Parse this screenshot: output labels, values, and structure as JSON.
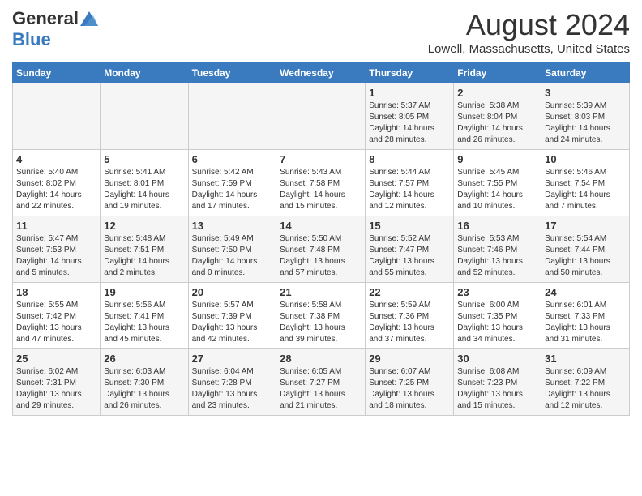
{
  "header": {
    "logo_general": "General",
    "logo_blue": "Blue",
    "month_year": "August 2024",
    "location": "Lowell, Massachusetts, United States"
  },
  "weekdays": [
    "Sunday",
    "Monday",
    "Tuesday",
    "Wednesday",
    "Thursday",
    "Friday",
    "Saturday"
  ],
  "weeks": [
    [
      {
        "day": "",
        "info": ""
      },
      {
        "day": "",
        "info": ""
      },
      {
        "day": "",
        "info": ""
      },
      {
        "day": "",
        "info": ""
      },
      {
        "day": "1",
        "info": "Sunrise: 5:37 AM\nSunset: 8:05 PM\nDaylight: 14 hours\nand 28 minutes."
      },
      {
        "day": "2",
        "info": "Sunrise: 5:38 AM\nSunset: 8:04 PM\nDaylight: 14 hours\nand 26 minutes."
      },
      {
        "day": "3",
        "info": "Sunrise: 5:39 AM\nSunset: 8:03 PM\nDaylight: 14 hours\nand 24 minutes."
      }
    ],
    [
      {
        "day": "4",
        "info": "Sunrise: 5:40 AM\nSunset: 8:02 PM\nDaylight: 14 hours\nand 22 minutes."
      },
      {
        "day": "5",
        "info": "Sunrise: 5:41 AM\nSunset: 8:01 PM\nDaylight: 14 hours\nand 19 minutes."
      },
      {
        "day": "6",
        "info": "Sunrise: 5:42 AM\nSunset: 7:59 PM\nDaylight: 14 hours\nand 17 minutes."
      },
      {
        "day": "7",
        "info": "Sunrise: 5:43 AM\nSunset: 7:58 PM\nDaylight: 14 hours\nand 15 minutes."
      },
      {
        "day": "8",
        "info": "Sunrise: 5:44 AM\nSunset: 7:57 PM\nDaylight: 14 hours\nand 12 minutes."
      },
      {
        "day": "9",
        "info": "Sunrise: 5:45 AM\nSunset: 7:55 PM\nDaylight: 14 hours\nand 10 minutes."
      },
      {
        "day": "10",
        "info": "Sunrise: 5:46 AM\nSunset: 7:54 PM\nDaylight: 14 hours\nand 7 minutes."
      }
    ],
    [
      {
        "day": "11",
        "info": "Sunrise: 5:47 AM\nSunset: 7:53 PM\nDaylight: 14 hours\nand 5 minutes."
      },
      {
        "day": "12",
        "info": "Sunrise: 5:48 AM\nSunset: 7:51 PM\nDaylight: 14 hours\nand 2 minutes."
      },
      {
        "day": "13",
        "info": "Sunrise: 5:49 AM\nSunset: 7:50 PM\nDaylight: 14 hours\nand 0 minutes."
      },
      {
        "day": "14",
        "info": "Sunrise: 5:50 AM\nSunset: 7:48 PM\nDaylight: 13 hours\nand 57 minutes."
      },
      {
        "day": "15",
        "info": "Sunrise: 5:52 AM\nSunset: 7:47 PM\nDaylight: 13 hours\nand 55 minutes."
      },
      {
        "day": "16",
        "info": "Sunrise: 5:53 AM\nSunset: 7:46 PM\nDaylight: 13 hours\nand 52 minutes."
      },
      {
        "day": "17",
        "info": "Sunrise: 5:54 AM\nSunset: 7:44 PM\nDaylight: 13 hours\nand 50 minutes."
      }
    ],
    [
      {
        "day": "18",
        "info": "Sunrise: 5:55 AM\nSunset: 7:42 PM\nDaylight: 13 hours\nand 47 minutes."
      },
      {
        "day": "19",
        "info": "Sunrise: 5:56 AM\nSunset: 7:41 PM\nDaylight: 13 hours\nand 45 minutes."
      },
      {
        "day": "20",
        "info": "Sunrise: 5:57 AM\nSunset: 7:39 PM\nDaylight: 13 hours\nand 42 minutes."
      },
      {
        "day": "21",
        "info": "Sunrise: 5:58 AM\nSunset: 7:38 PM\nDaylight: 13 hours\nand 39 minutes."
      },
      {
        "day": "22",
        "info": "Sunrise: 5:59 AM\nSunset: 7:36 PM\nDaylight: 13 hours\nand 37 minutes."
      },
      {
        "day": "23",
        "info": "Sunrise: 6:00 AM\nSunset: 7:35 PM\nDaylight: 13 hours\nand 34 minutes."
      },
      {
        "day": "24",
        "info": "Sunrise: 6:01 AM\nSunset: 7:33 PM\nDaylight: 13 hours\nand 31 minutes."
      }
    ],
    [
      {
        "day": "25",
        "info": "Sunrise: 6:02 AM\nSunset: 7:31 PM\nDaylight: 13 hours\nand 29 minutes."
      },
      {
        "day": "26",
        "info": "Sunrise: 6:03 AM\nSunset: 7:30 PM\nDaylight: 13 hours\nand 26 minutes."
      },
      {
        "day": "27",
        "info": "Sunrise: 6:04 AM\nSunset: 7:28 PM\nDaylight: 13 hours\nand 23 minutes."
      },
      {
        "day": "28",
        "info": "Sunrise: 6:05 AM\nSunset: 7:27 PM\nDaylight: 13 hours\nand 21 minutes."
      },
      {
        "day": "29",
        "info": "Sunrise: 6:07 AM\nSunset: 7:25 PM\nDaylight: 13 hours\nand 18 minutes."
      },
      {
        "day": "30",
        "info": "Sunrise: 6:08 AM\nSunset: 7:23 PM\nDaylight: 13 hours\nand 15 minutes."
      },
      {
        "day": "31",
        "info": "Sunrise: 6:09 AM\nSunset: 7:22 PM\nDaylight: 13 hours\nand 12 minutes."
      }
    ]
  ]
}
